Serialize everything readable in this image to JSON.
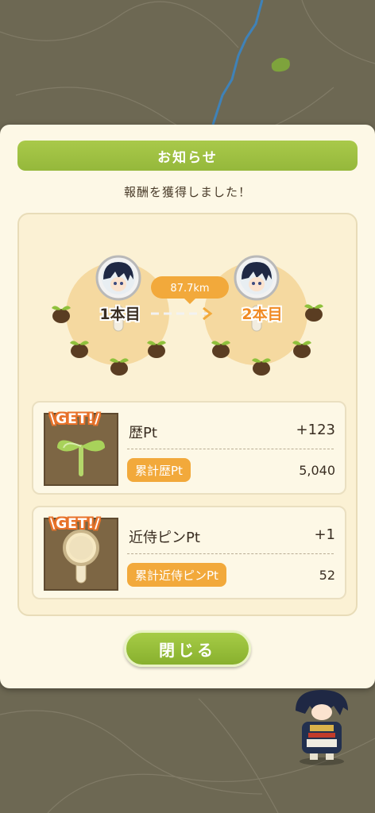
{
  "dialog": {
    "title": "お知らせ",
    "message": "報酬を獲得しました！",
    "close_label": "閉じる"
  },
  "route": {
    "from_label": "1本目",
    "to_label": "2本目",
    "distance": "87.7km"
  },
  "rewards": [
    {
      "get_label": "\\GET!/",
      "name": "歴Pt",
      "gain": "+123",
      "total_label": "累計歴Pt",
      "total_value": "5,040",
      "icon": "sprout-icon"
    },
    {
      "get_label": "\\GET!/",
      "name": "近侍ピンPt",
      "gain": "+1",
      "total_label": "累計近侍ピンPt",
      "total_value": "52",
      "icon": "magnifier-pin-icon"
    }
  ],
  "colors": {
    "title_bar": "#a2c446",
    "accent_orange": "#f2a93b",
    "dialog_bg": "#fdf8e6",
    "map_bg": "#6f6a55"
  }
}
